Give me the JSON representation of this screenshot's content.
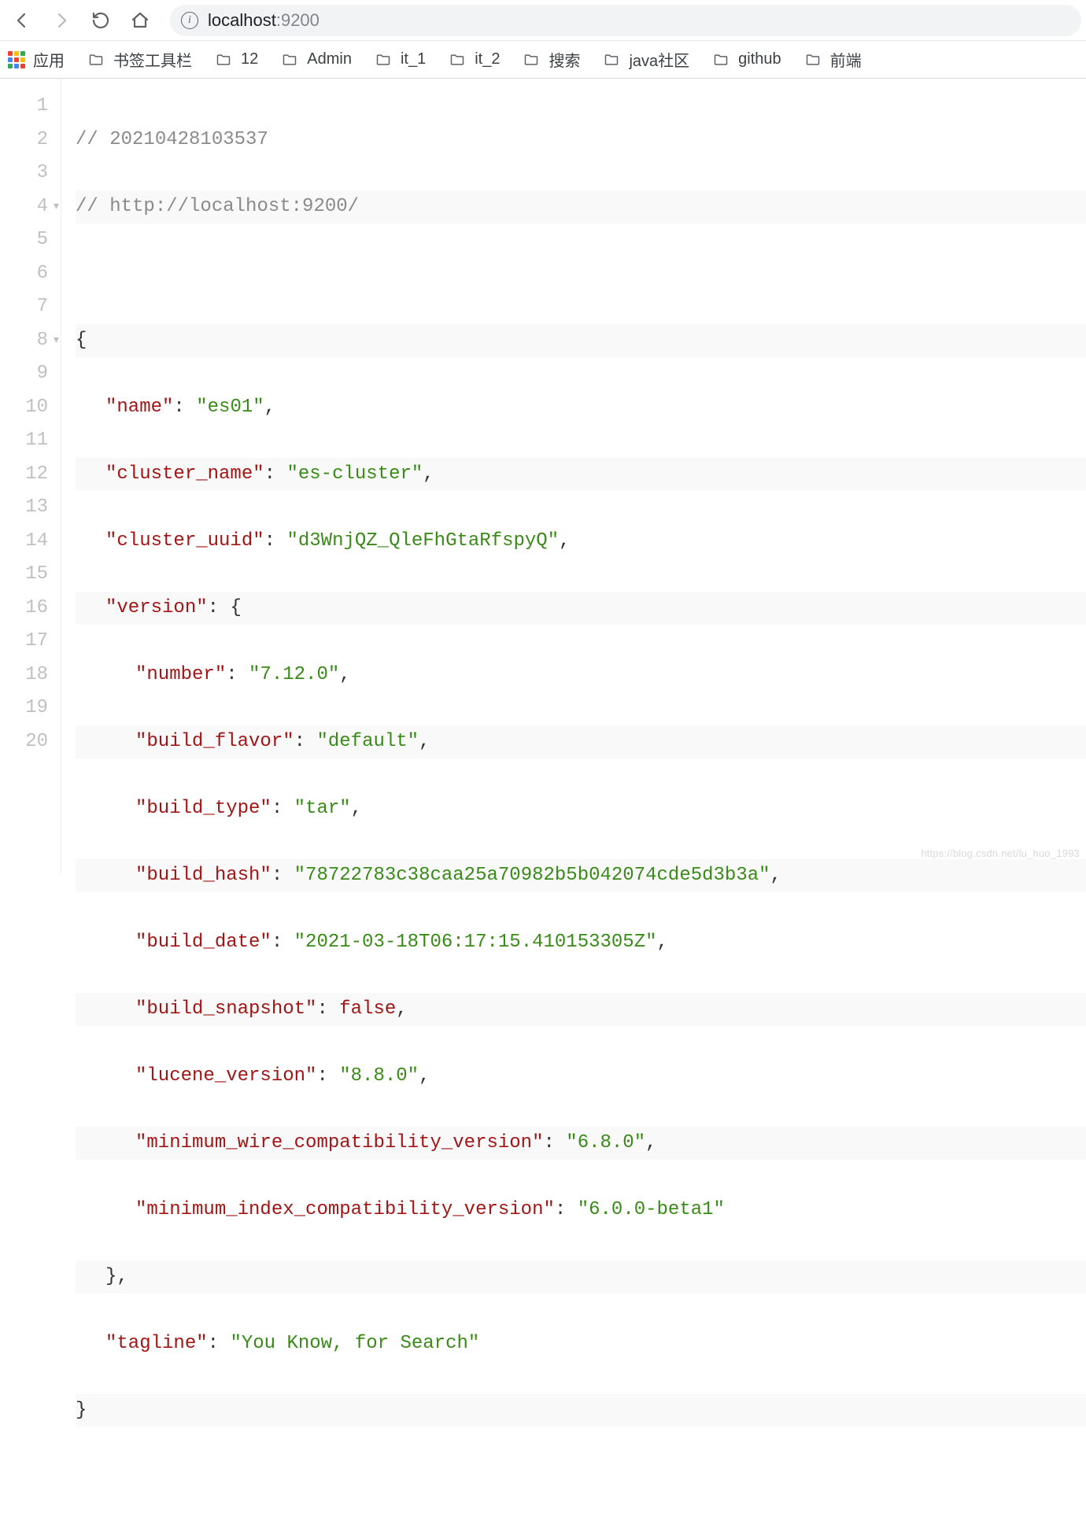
{
  "toolbar": {
    "url_domain": "localhost",
    "url_port": ":9200"
  },
  "bookmarks": {
    "apps_label": "应用",
    "apps_colors": [
      "#ea4335",
      "#fbbc05",
      "#34a853",
      "#4285f4",
      "#ea4335",
      "#fbbc05",
      "#34a853",
      "#4285f4",
      "#ea4335"
    ],
    "items": [
      {
        "label": "书签工具栏"
      },
      {
        "label": "12"
      },
      {
        "label": "Admin"
      },
      {
        "label": "it_1"
      },
      {
        "label": "it_2"
      },
      {
        "label": "搜索"
      },
      {
        "label": "java社区"
      },
      {
        "label": "github"
      },
      {
        "label": "前端"
      }
    ]
  },
  "code": {
    "comment1": "// 20210428103537",
    "comment2": "// http://localhost:9200/",
    "brace_open": "{",
    "name_k": "\"name\"",
    "name_v": "\"es01\"",
    "cluster_name_k": "\"cluster_name\"",
    "cluster_name_v": "\"es-cluster\"",
    "cluster_uuid_k": "\"cluster_uuid\"",
    "cluster_uuid_v": "\"d3WnjQZ_QleFhGtaRfspyQ\"",
    "version_k": "\"version\"",
    "version_open": "{",
    "number_k": "\"number\"",
    "number_v": "\"7.12.0\"",
    "build_flavor_k": "\"build_flavor\"",
    "build_flavor_v": "\"default\"",
    "build_type_k": "\"build_type\"",
    "build_type_v": "\"tar\"",
    "build_hash_k": "\"build_hash\"",
    "build_hash_v": "\"78722783c38caa25a70982b5b042074cde5d3b3a\"",
    "build_date_k": "\"build_date\"",
    "build_date_v": "\"2021-03-18T06:17:15.410153305Z\"",
    "build_snapshot_k": "\"build_snapshot\"",
    "build_snapshot_v": "false",
    "lucene_version_k": "\"lucene_version\"",
    "lucene_version_v": "\"8.8.0\"",
    "mwcv_k": "\"minimum_wire_compatibility_version\"",
    "mwcv_v": "\"6.8.0\"",
    "micv_k": "\"minimum_index_compatibility_version\"",
    "micv_v": "\"6.0.0-beta1\"",
    "version_close": "},",
    "tagline_k": "\"tagline\"",
    "tagline_v": "\"You Know, for Search\"",
    "brace_close": "}"
  },
  "lines": [
    "1",
    "2",
    "3",
    "4",
    "5",
    "6",
    "7",
    "8",
    "9",
    "10",
    "11",
    "12",
    "13",
    "14",
    "15",
    "16",
    "17",
    "18",
    "19",
    "20"
  ],
  "watermark": "https://blog.csdn.net/lu_huo_1993"
}
